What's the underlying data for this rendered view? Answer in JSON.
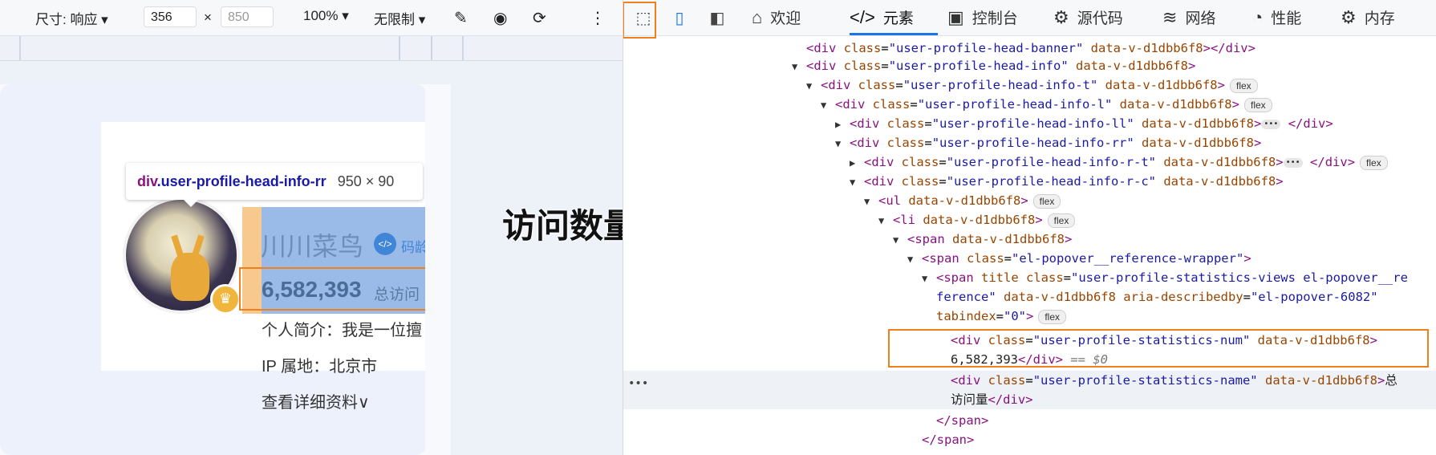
{
  "device_toolbar": {
    "size_label": "尺寸: 响应",
    "width": "356",
    "x": "×",
    "height": "850",
    "zoom": "100%",
    "throttle": "无限制"
  },
  "preview": {
    "tooltip_selector": "div",
    "tooltip_class": ".user-profile-head-info-rr",
    "tooltip_dims": "950 × 90",
    "user_name": "川川菜鸟",
    "code_badge": "码龄",
    "visit_number": "6,582,393",
    "visit_label": "总访问",
    "intro": "个人简介：我是一位擅",
    "ip": "IP 属地：北京市",
    "more": "查看详细资料∨",
    "crown": "♛"
  },
  "caption": "访问数量定位",
  "tabs": [
    {
      "icon": "⌂",
      "label": "欢迎"
    },
    {
      "icon": "</>",
      "label": "元素"
    },
    {
      "icon": "▣",
      "label": "控制台"
    },
    {
      "icon": "⚙",
      "label": "源代码"
    },
    {
      "icon": "≋",
      "label": "网络"
    },
    {
      "icon": "◔",
      "label": "性能"
    },
    {
      "icon": "⚙",
      "label": "内存"
    }
  ],
  "dom": {
    "l1": {
      "tag_open": "<div ",
      "attr": "class",
      "val": "\"user-profile-head-banner\"",
      "attr2": " data-v-d1dbb6f8",
      "tail": "></div>"
    },
    "l2": {
      "tag_open": "<div ",
      "attr": "class",
      "val": "\"user-profile-head-info\"",
      "attr2": " data-v-d1dbb6f8",
      "tail": ">"
    },
    "l3": {
      "tag_open": "<div ",
      "attr": "class",
      "val": "\"user-profile-head-info-t\"",
      "attr2": " data-v-d1dbb6f8",
      "tail": ">",
      "pill": "flex"
    },
    "l4": {
      "tag_open": "<div ",
      "attr": "class",
      "val": "\"user-profile-head-info-l\"",
      "attr2": " data-v-d1dbb6f8",
      "tail": ">",
      "pill": "flex"
    },
    "l5": {
      "tag_open": "<div ",
      "attr": "class",
      "val": "\"user-profile-head-info-ll\"",
      "attr2": " data-v-d1dbb6f8",
      "tail": ">",
      "dots": "•••",
      "close": "</div>"
    },
    "l6": {
      "tag_open": "<div ",
      "attr": "class",
      "val": "\"user-profile-head-info-rr\"",
      "attr2": " data-v-d1dbb6f8",
      "tail": ">"
    },
    "l7": {
      "tag_open": "<div ",
      "attr": "class",
      "val": "\"user-profile-head-info-r-t\"",
      "attr2": " data-v-d1dbb6f8",
      "tail": ">",
      "dots": "•••",
      "close": "</div>",
      "pill": "flex"
    },
    "l8": {
      "tag_open": "<div ",
      "attr": "class",
      "val": "\"user-profile-head-info-r-c\"",
      "attr2": " data-v-d1dbb6f8",
      "tail": ">"
    },
    "l9": {
      "tag_open": "<ul",
      "attr2": " data-v-d1dbb6f8",
      "tail": ">",
      "pill": "flex"
    },
    "l10": {
      "tag_open": "<li",
      "attr2": " data-v-d1dbb6f8",
      "tail": ">",
      "pill": "flex"
    },
    "l11": {
      "tag_open": "<span",
      "attr2": " data-v-d1dbb6f8",
      "tail": ">"
    },
    "l12": {
      "tag_open": "<span ",
      "attr": "class",
      "val": "\"el-popover__reference-wrapper\"",
      "tail": ">"
    },
    "l13": {
      "tag_open": "<span ",
      "attr": "title class",
      "val": "\"user-profile-statistics-views el-popover__re"
    },
    "l14": {
      "val": "ference\"",
      "attr2": " data-v-d1dbb6f8 aria-describedby",
      "val2": "\"el-popover-6082\""
    },
    "l15": {
      "attr": "tabindex",
      "val": "\"0\"",
      "tail": ">",
      "pill": "flex"
    },
    "l16": {
      "tag_open": "<div ",
      "attr": "class",
      "val": "\"user-profile-statistics-num\"",
      "attr2": " data-v-d1dbb6f8",
      "tail": ">"
    },
    "l17": {
      "txt": "6,582,393",
      "close": "</div>",
      "eq": " == $0"
    },
    "l18": {
      "tag_open": "<div ",
      "attr": "class",
      "val": "\"user-profile-statistics-name\"",
      "attr2": " data-v-d1dbb6f8",
      "tail": ">",
      "txt": "总"
    },
    "l19": {
      "txt": "访问量",
      "close": "</div>"
    },
    "l20": {
      "close": "</span>"
    },
    "l21": {
      "close": "</span>"
    }
  },
  "gutter": "•••",
  "colors": {
    "highlight": "#f07f1e",
    "tag": "#881280",
    "attr": "#994500",
    "value": "#1a1aa6",
    "accent": "#1a73e8"
  }
}
